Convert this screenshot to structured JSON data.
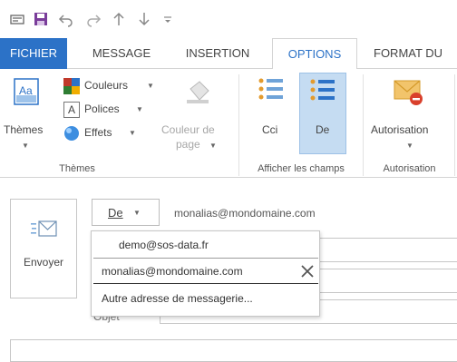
{
  "quick_access": {
    "icons": [
      "email-icon",
      "save-icon",
      "undo-icon",
      "redo-icon",
      "previous-item-icon",
      "next-item-icon",
      "customize-toolbar-icon"
    ]
  },
  "tabs": [
    {
      "label": "FICHIER"
    },
    {
      "label": "MESSAGE"
    },
    {
      "label": "INSERTION"
    },
    {
      "label": "OPTIONS"
    },
    {
      "label": "FORMAT DU"
    }
  ],
  "ribbon": {
    "themes_group": {
      "themes_label": "Thèmes",
      "colors_label": "Couleurs",
      "fonts_label": "Polices",
      "effects_label": "Effets",
      "group_label": "Thèmes"
    },
    "page_color": {
      "line1": "Couleur de",
      "line2": "page"
    },
    "show_fields_group": {
      "bcc_label": "Cci",
      "from_label": "De",
      "group_label": "Afficher les champs"
    },
    "permission_group": {
      "permission_label": "Autorisation",
      "group_label": "Autorisation"
    }
  },
  "compose": {
    "send_label": "Envoyer",
    "from_button_label": "De",
    "from_address": "monalias@mondomaine.com",
    "subject_label": "Objet",
    "dropdown": {
      "items": [
        {
          "label": "demo@sos-data.fr"
        },
        {
          "label": "monalias@mondomaine.com"
        },
        {
          "label": "Autre adresse de messagerie..."
        }
      ]
    }
  },
  "colors": {
    "accent": "#2c72c7",
    "active_toggle": "#c5dcf2"
  }
}
